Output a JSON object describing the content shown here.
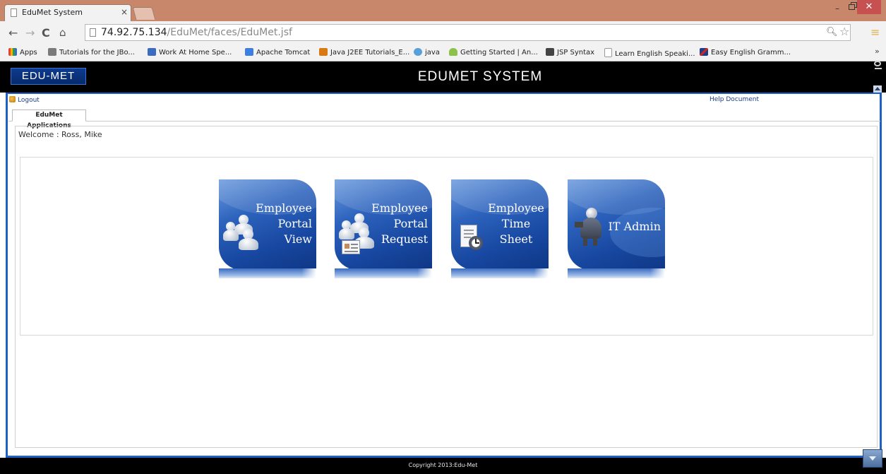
{
  "browser": {
    "tab_title": "EduMet System",
    "tab_close": "×",
    "url_host": "74.92.75.134",
    "url_path": "/EduMet/faces/EduMet.jsf",
    "bookmarks": [
      {
        "label": "Apps",
        "color": "#e34234"
      },
      {
        "label": "Tutorials for the JBo...",
        "color": "#7b7b7b"
      },
      {
        "label": "Work At Home Spe...",
        "color": "#3a6cc0"
      },
      {
        "label": "Apache Tomcat",
        "color": "#3d7fe0"
      },
      {
        "label": "Java J2EE Tutorials_E...",
        "color": "#d87a10"
      },
      {
        "label": "java",
        "color": "#5aa0d8"
      },
      {
        "label": "Getting Started | An...",
        "color": "#8bc34a"
      },
      {
        "label": "JSP Syntax",
        "color": "#444444"
      },
      {
        "label": "Learn English Speaki...",
        "color": "#999999"
      },
      {
        "label": "Easy English Gramm...",
        "color": "#c62828"
      }
    ],
    "more": "»"
  },
  "header": {
    "logo_text": "EDU-MET",
    "title": "EDUMET SYSTEM"
  },
  "toolbar": {
    "logout": "Logout",
    "help": "Help Document"
  },
  "tabs": [
    {
      "label": "EduMet Applications"
    }
  ],
  "welcome": "Welcome : Ross, Mike",
  "tiles": [
    {
      "label": "Employee\nPortal\nView"
    },
    {
      "label": "Employee\nPortal\nRequest"
    },
    {
      "label": "Employee\nTime\nSheet"
    },
    {
      "label": "IT Admin"
    }
  ],
  "footer": {
    "copyright": "Copyright 2013:Edu-Met"
  },
  "colors": {
    "accent": "#1e60c8",
    "tile_blue": "#1747a0",
    "header_bg": "#000000"
  }
}
